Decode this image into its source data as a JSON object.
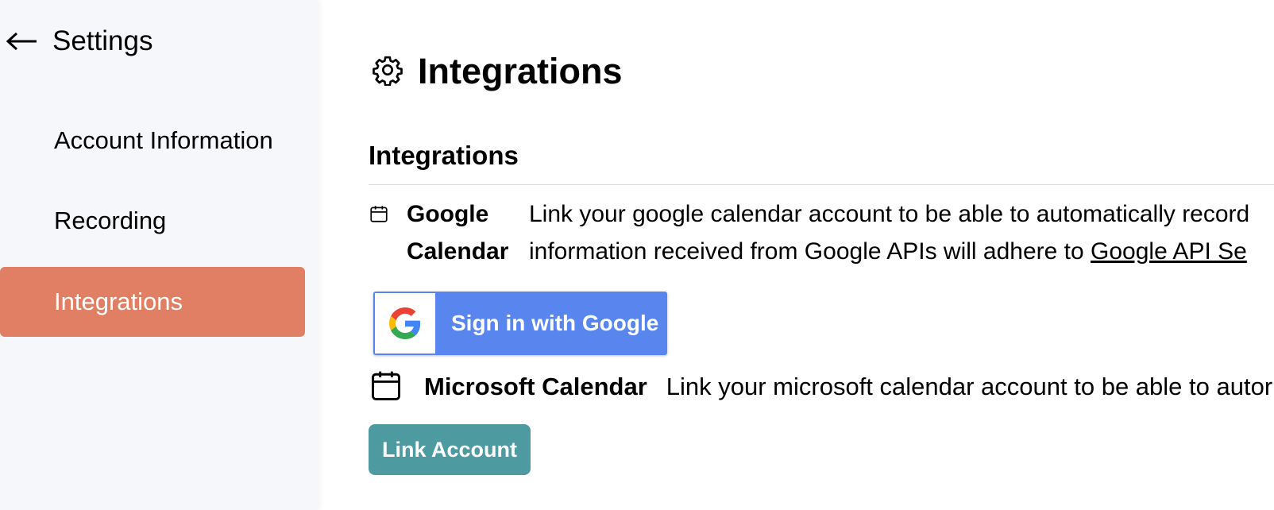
{
  "sidebar": {
    "back_icon": "arrow-left-icon",
    "title": "Settings",
    "items": [
      {
        "label": "Account Information",
        "active": false
      },
      {
        "label": "Recording",
        "active": false
      },
      {
        "label": "Integrations",
        "active": true
      }
    ],
    "active_color": "#e07f64"
  },
  "main": {
    "title_icon": "gear-icon",
    "title": "Integrations",
    "section_title": "Integrations",
    "google": {
      "icon": "calendar-icon",
      "name": "Google Calendar",
      "description_line1": "Link your google calendar account to be able to automatically record",
      "description_line2_prefix": "information received from Google APIs will adhere to ",
      "description_link": "Google API Se",
      "button_icon": "google-g-icon",
      "button_label": "Sign in with Google",
      "button_color": "#5886ee"
    },
    "microsoft": {
      "icon": "calendar-icon",
      "name": "Microsoft Calendar",
      "description": "Link your microsoft calendar account to be able to autor",
      "button_label": "Link Account",
      "button_color": "#4d9aa1"
    }
  }
}
